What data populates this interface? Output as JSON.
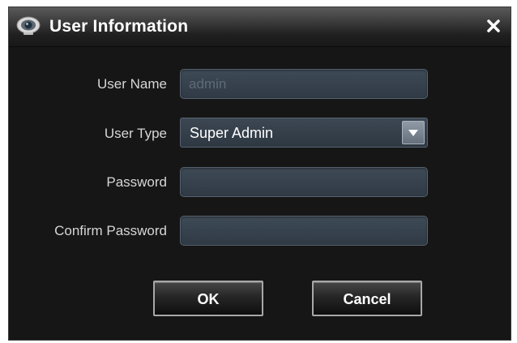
{
  "dialog": {
    "title": "User Information",
    "icons": {
      "app": "camera-icon",
      "close": "close-icon"
    }
  },
  "form": {
    "user_name": {
      "label": "User Name",
      "value": "admin",
      "disabled": true
    },
    "user_type": {
      "label": "User Type",
      "selected": "Super Admin"
    },
    "password": {
      "label": "Password",
      "value": ""
    },
    "confirm_password": {
      "label": "Confirm Password",
      "value": ""
    }
  },
  "buttons": {
    "ok": "OK",
    "cancel": "Cancel"
  },
  "colors": {
    "dialog_bg": "#161616",
    "field_bg": "#34404c",
    "text": "#ffffff",
    "label": "#d6d6d6"
  }
}
